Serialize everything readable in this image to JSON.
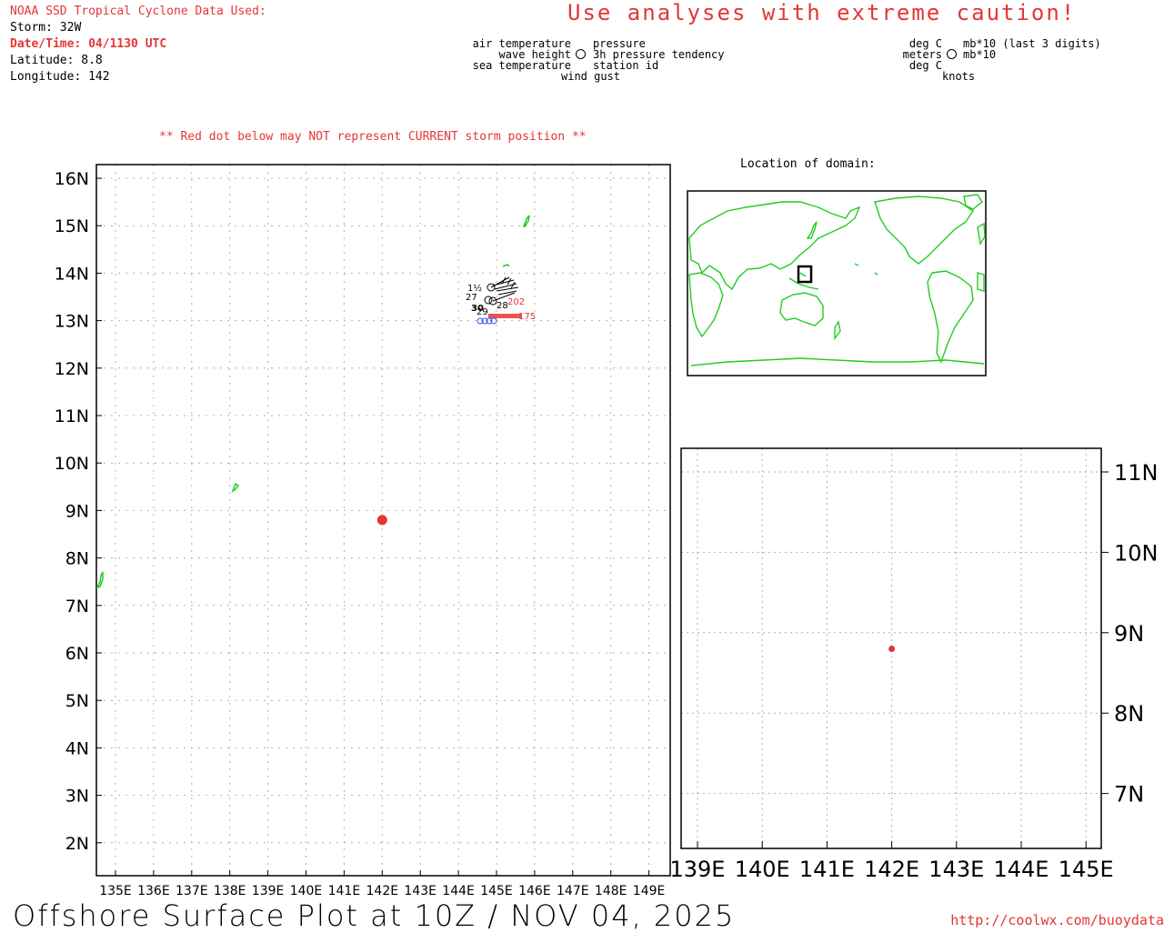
{
  "header": {
    "source_title": "NOAA SSD Tropical Cyclone Data Used:",
    "storm": "Storm: 32W",
    "datetime": "Date/Time: 04/1130 UTC",
    "latitude": "Latitude: 8.8",
    "longitude": "Longitude: 142",
    "caution": "Use analyses with extreme caution!",
    "red_dot_note": "** Red dot below may NOT represent CURRENT storm position **",
    "location_title": "Location of domain:"
  },
  "legend": {
    "left_col": [
      "air temperature",
      "wave height",
      "sea temperature"
    ],
    "right_col": [
      "pressure",
      "3h pressure tendency",
      "station id"
    ],
    "bottom": "wind gust",
    "units_left": [
      "deg C",
      "meters",
      "deg C"
    ],
    "units_right": [
      "mb*10 (last 3 digits)",
      "mb*10"
    ],
    "units_bottom": "knots"
  },
  "main_map": {
    "lon_labels": [
      "135E",
      "136E",
      "137E",
      "138E",
      "139E",
      "140E",
      "141E",
      "142E",
      "143E",
      "144E",
      "145E",
      "146E",
      "147E",
      "148E",
      "149E"
    ],
    "lat_labels": [
      "16N",
      "15N",
      "14N",
      "13N",
      "12N",
      "11N",
      "10N",
      "9N",
      "8N",
      "7N",
      "6N",
      "5N",
      "4N",
      "3N",
      "2N"
    ],
    "storm_lat": 8.8,
    "storm_lon": 142,
    "station_labels": [
      "1½",
      "27",
      "30",
      "29",
      "202",
      "28",
      "175"
    ]
  },
  "zoom_map": {
    "lon_labels": [
      "139E",
      "140E",
      "141E",
      "142E",
      "143E",
      "144E",
      "145E"
    ],
    "lat_labels": [
      "11N",
      "10N",
      "9N",
      "8N",
      "7N"
    ],
    "storm_lat": 8.8,
    "storm_lon": 142
  },
  "footer": {
    "title": "Offshore Surface Plot at 10Z / NOV 04, 2025",
    "url": "http://coolwx.com/buoydata"
  },
  "colors": {
    "red": "#e53535",
    "coast": "#22cc22",
    "grid": "#b0b0b0",
    "sea_temp": "#3355ee"
  }
}
